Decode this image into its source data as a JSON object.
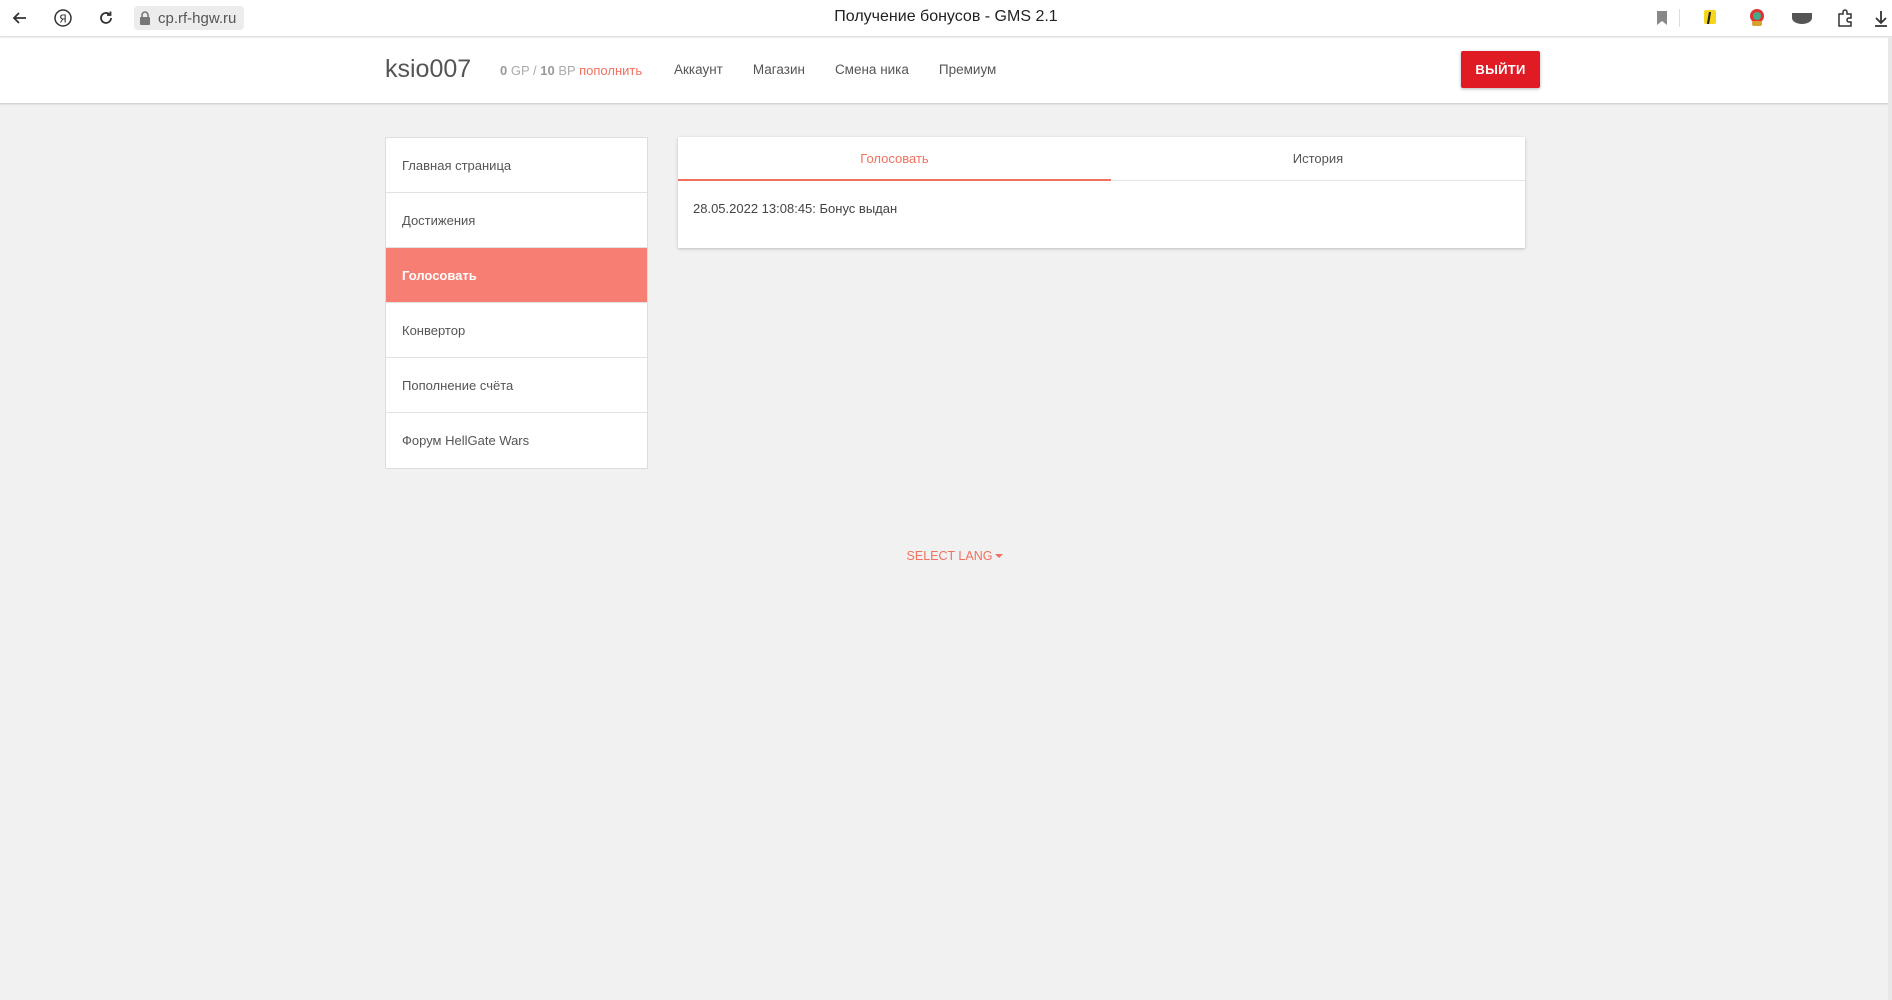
{
  "browser": {
    "url": "cp.rf-hgw.ru",
    "tab_title": "Получение бонусов - GMS 2.1"
  },
  "header": {
    "username": "ksio007",
    "gp_value": "0",
    "gp_unit": "GP",
    "separator": "/",
    "bp_value": "10",
    "bp_unit": "BP",
    "topup_label": "пополнить",
    "nav": [
      {
        "label": "Аккаунт"
      },
      {
        "label": "Магазин"
      },
      {
        "label": "Смена ника"
      },
      {
        "label": "Премиум"
      }
    ],
    "logout_label": "ВЫЙТИ"
  },
  "sidebar": {
    "items": [
      {
        "label": "Главная страница"
      },
      {
        "label": "Достижения"
      },
      {
        "label": "Голосовать"
      },
      {
        "label": "Конвертор"
      },
      {
        "label": "Пополнение счёта"
      },
      {
        "label": "Форум HellGate Wars"
      }
    ]
  },
  "main": {
    "tabs": [
      {
        "label": "Голосовать"
      },
      {
        "label": "История"
      }
    ],
    "log_entry": "28.05.2022 13:08:45: Бонус выдан"
  },
  "footer": {
    "lang_label": "SELECT LANG"
  },
  "colors": {
    "accent": "#f2705f",
    "active_bg": "#f77e72",
    "logout_bg": "#e01b24",
    "page_bg": "#f1f1f1"
  }
}
